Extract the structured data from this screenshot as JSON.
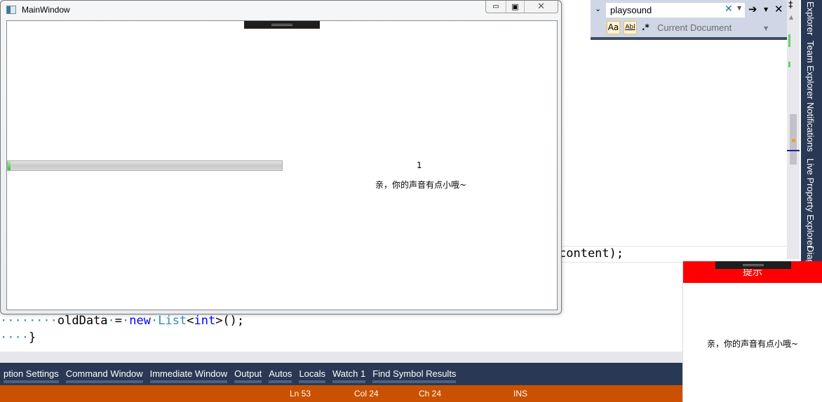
{
  "editor": {
    "line_content": "content);",
    "line_olddata": [
      {
        "t": "········",
        "c": "ws"
      },
      {
        "t": "oldData",
        "c": ""
      },
      {
        "t": "·",
        "c": "ws"
      },
      {
        "t": "=",
        "c": ""
      },
      {
        "t": "·",
        "c": "ws"
      },
      {
        "t": "new",
        "c": "kw"
      },
      {
        "t": "·",
        "c": "ws"
      },
      {
        "t": "List",
        "c": "ty"
      },
      {
        "t": "<",
        "c": ""
      },
      {
        "t": "int",
        "c": "kw"
      },
      {
        "t": ">();",
        "c": ""
      }
    ],
    "line_brace_ws": "····",
    "line_brace": "}"
  },
  "find": {
    "value": "playsound",
    "scope": "Current Document",
    "match_case": "Aa",
    "whole_word": "Abl",
    "regex": ".*"
  },
  "side_tabs": [
    "Explorer",
    "Team Explorer",
    "Notifications",
    "Live Property Explorer",
    "Diag"
  ],
  "tool_tabs": [
    "ption Settings",
    "Command Window",
    "Immediate Window",
    "Output",
    "Autos",
    "Locals",
    "Watch 1",
    "Find Symbol Results"
  ],
  "status": {
    "ln": "Ln 53",
    "col": "Col 24",
    "ch": "Ch 24",
    "mode": "INS"
  },
  "main_window": {
    "title": "MainWindow",
    "progress_percent": 1,
    "counter": "1",
    "message": "亲，你的声音有点小哦~"
  },
  "toast": {
    "title": "提示",
    "message": "亲，你的声音有点小哦~",
    "header_color": "#ff0000"
  },
  "colors": {
    "status_bar": "#ca5100",
    "tool_bar": "#293955"
  }
}
